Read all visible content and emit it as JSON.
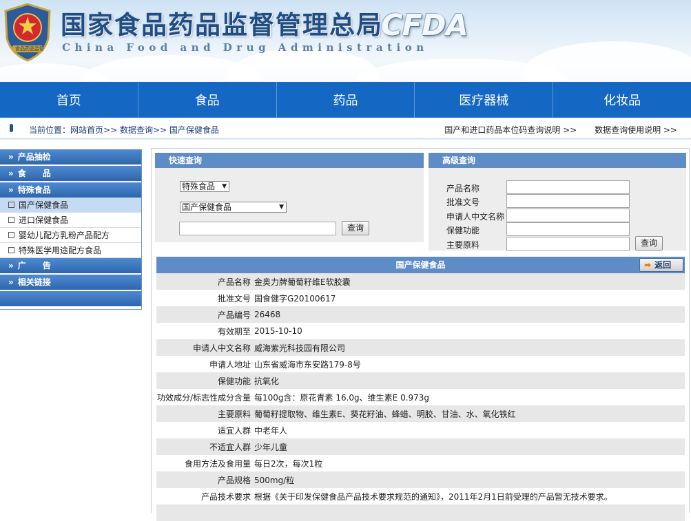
{
  "header": {
    "title_cn": "国家食品药品监督管理总局",
    "title_en": "China Food and Drug Administration",
    "logo_text": "CFDA",
    "emblem_caption": "食品药品监管"
  },
  "nav": [
    {
      "label": "首页"
    },
    {
      "label": "食品"
    },
    {
      "label": "药品"
    },
    {
      "label": "医疗器械"
    },
    {
      "label": "化妆品"
    }
  ],
  "location": {
    "prefix": "当前位置：",
    "crumbs": [
      "网站首页",
      "数据查询",
      "国产保健食品"
    ],
    "separator": ">>",
    "links": [
      "国产和进口药品本位码查询说明 >>",
      "数据查询使用说明 >>"
    ]
  },
  "sidebar": {
    "arrow": "»",
    "categories": [
      "产品抽检",
      "食　　品",
      "特殊食品",
      "广　　告",
      "相关链接"
    ],
    "sub_items": [
      "国产保健食品",
      "进口保健食品",
      "婴幼儿配方乳粉产品配方",
      "特殊医学用途配方食品"
    ]
  },
  "quick_search": {
    "title": "快速查询",
    "select1": "特殊食品",
    "select2": "国产保健食品",
    "input_value": "",
    "button": "查询"
  },
  "advanced_search": {
    "title": "高级查询",
    "fields": [
      "产品名称",
      "批准文号",
      "申请人中文名称",
      "保健功能",
      "主要原料"
    ],
    "button": "查询"
  },
  "detail": {
    "title": "国产保健食品",
    "back_label": "返回",
    "rows": [
      {
        "k": "产品名称",
        "v": "金奥力牌葡萄籽维E软胶囊"
      },
      {
        "k": "批准文号",
        "v": "国食健字G20100617"
      },
      {
        "k": "产品编号",
        "v": "26468"
      },
      {
        "k": "有效期至",
        "v": "2015-10-10"
      },
      {
        "k": "申请人中文名称",
        "v": "威海紫光科技园有限公司"
      },
      {
        "k": "申请人地址",
        "v": "山东省威海市东安路179-8号"
      },
      {
        "k": "保健功能",
        "v": "抗氧化"
      },
      {
        "k": "功效成分/标志性成分含量",
        "v": "每100g含：原花青素 16.0g、维生素E 0.973g"
      },
      {
        "k": "主要原料",
        "v": "葡萄籽提取物、维生素E、葵花籽油、蜂蜡、明胶、甘油、水、氧化铁红"
      },
      {
        "k": "适宜人群",
        "v": "中老年人"
      },
      {
        "k": "不适宜人群",
        "v": "少年儿童"
      },
      {
        "k": "食用方法及食用量",
        "v": "每日2次，每次1粒"
      },
      {
        "k": "产品规格",
        "v": "500mg/粒"
      },
      {
        "k": "产品技术要求",
        "v": "根据《关于印发保健食品产品技术要求规范的通知》，2011年2月1日前受理的产品暂无技术要求。"
      },
      {
        "k": "",
        "v": ""
      }
    ]
  },
  "colors": {
    "nav_blue": "#1467c3",
    "panel_blue": "#5e8cc6",
    "sidebar_blue": "#2d66ae",
    "row_gray": "#e7e7e7"
  }
}
